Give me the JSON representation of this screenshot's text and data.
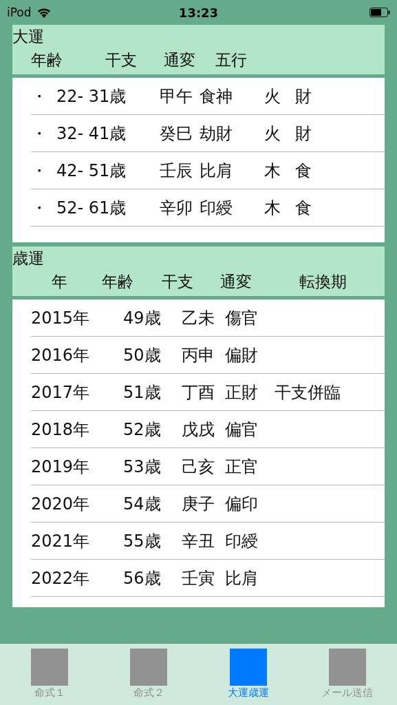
{
  "status_bar": {
    "carrier": "iPod",
    "time": "13:23"
  },
  "daiun": {
    "title": "大運",
    "columns": [
      "年齢",
      "干支",
      "通変",
      "五行"
    ],
    "rows": [
      {
        "bullet": "・",
        "age": "22- 31歳",
        "kanshi": "甲午",
        "tsuhen": "食神",
        "gogyo": "火",
        "category": "財"
      },
      {
        "bullet": "・",
        "age": "32- 41歳",
        "kanshi": "癸巳",
        "tsuhen": "劫財",
        "gogyo": "火",
        "category": "財"
      },
      {
        "bullet": "・",
        "age": "42- 51歳",
        "kanshi": "壬辰",
        "tsuhen": "比肩",
        "gogyo": "木",
        "category": "食"
      },
      {
        "bullet": "・",
        "age": "52- 61歳",
        "kanshi": "辛卯",
        "tsuhen": "印綬",
        "gogyo": "木",
        "category": "食"
      }
    ]
  },
  "saiun": {
    "title": "歳運",
    "columns": [
      "年",
      "年齢",
      "干支",
      "通変",
      "転換期"
    ],
    "rows": [
      {
        "year": "2015年",
        "age": "49歳",
        "kanshi": "乙未",
        "tsuhen": "傷官"
      },
      {
        "year": "2016年",
        "age": "50歳",
        "kanshi": "丙申",
        "tsuhen": "偏財"
      },
      {
        "year": "2017年",
        "age": "51歳",
        "kanshi": "丁酉",
        "tsuhen": "正財",
        "turning": "干支併臨"
      },
      {
        "year": "2018年",
        "age": "52歳",
        "kanshi": "戊戌",
        "tsuhen": "偏官"
      },
      {
        "year": "2019年",
        "age": "53歳",
        "kanshi": "己亥",
        "tsuhen": "正官"
      },
      {
        "year": "2020年",
        "age": "54歳",
        "kanshi": "庚子",
        "tsuhen": "偏印"
      },
      {
        "year": "2021年",
        "age": "55歳",
        "kanshi": "辛丑",
        "tsuhen": "印綬"
      },
      {
        "year": "2022年",
        "age": "56歳",
        "kanshi": "壬寅",
        "tsuhen": "比肩"
      }
    ]
  },
  "tab_bar": [
    {
      "label": "命式１",
      "selected": false
    },
    {
      "label": "命式２",
      "selected": false
    },
    {
      "label": "大運歳運",
      "selected": true
    },
    {
      "label": "メール送信",
      "selected": false
    }
  ]
}
